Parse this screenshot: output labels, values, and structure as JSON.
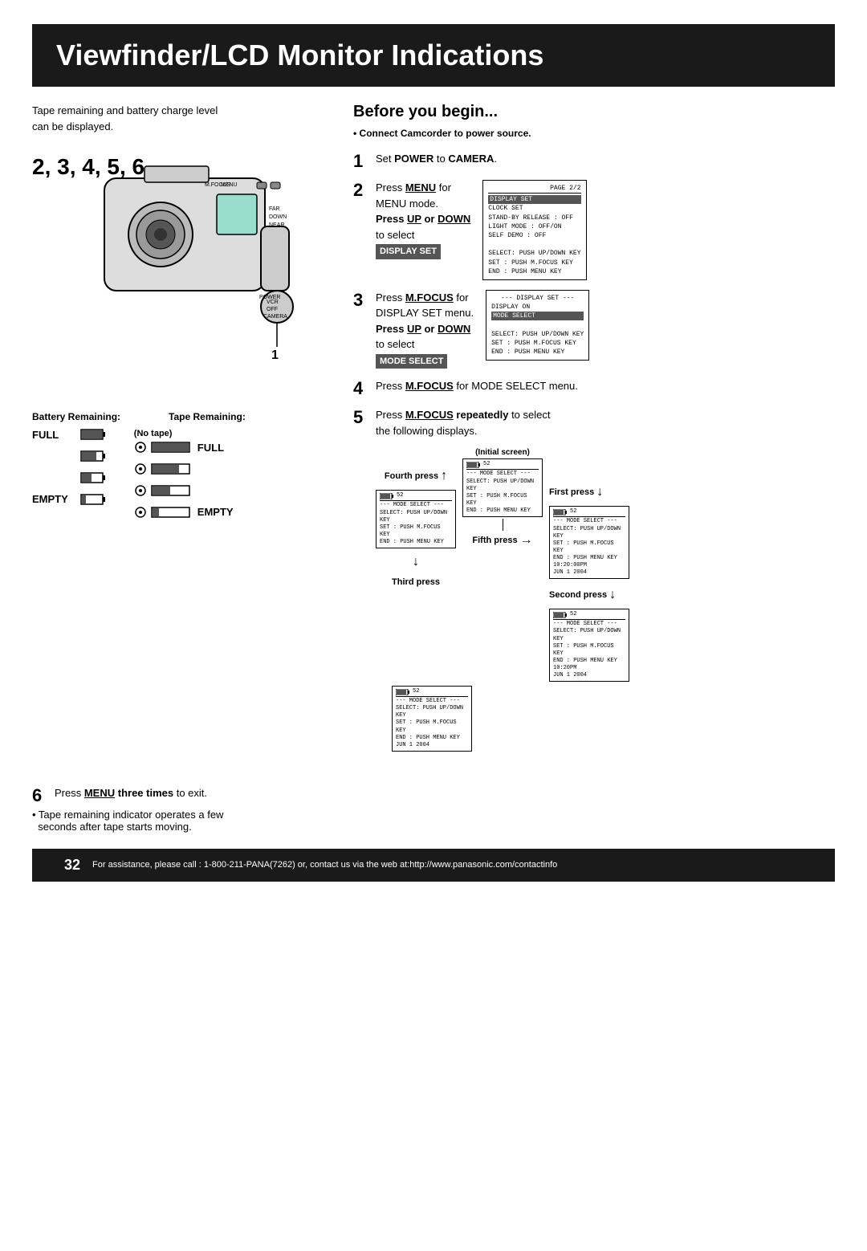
{
  "title": "Viewfinder/LCD Monitor Indications",
  "intro": {
    "line1": "Tape remaining and battery charge level",
    "line2": "can be displayed."
  },
  "before_heading": "Before you begin...",
  "connect_note": "Connect Camcorder to power source.",
  "steps": [
    {
      "num": "1",
      "text": "Set POWER to CAMERA."
    },
    {
      "num": "2",
      "text_pre": "Press ",
      "bold1": "MENU",
      "text1": " for\nMENU mode.\n",
      "bold2": "Press UP or DOWN",
      "text2": "\nto select\n",
      "highlight": "DISPLAY SET"
    },
    {
      "num": "3",
      "text_pre": "Press ",
      "bold1": "M.FOCUS",
      "text1": " for\nDISPLAY SET menu.\n",
      "bold2": "Press UP or DOWN",
      "text2": "\nto select\n",
      "highlight": "MODE SELECT"
    },
    {
      "num": "4",
      "text": "Press M.FOCUS for MODE SELECT menu."
    },
    {
      "num": "5",
      "text_pre": "Press ",
      "bold": "M.FOCUS repeatedly",
      "text": " to select\nthe following displays."
    }
  ],
  "step6": {
    "num": "6",
    "bold": "Press MENU three times",
    "text": " to exit."
  },
  "bottom_note": "• Tape remaining indicator operates a few\n  seconds after tape starts moving.",
  "battery_section": {
    "header1": "Battery Remaining:",
    "header2": "Tape Remaining:",
    "no_tape": "(No tape)",
    "full": "FULL",
    "empty": "EMPTY"
  },
  "number_label": "2, 3, 4, 5, 6",
  "press_labels": {
    "initial": "(Initial screen)",
    "fifth": "Fifth press",
    "first": "First press",
    "fourth": "Fourth press",
    "second": "Second press",
    "third": "Third press"
  },
  "menu_step2": {
    "header": "PAGE 2/2",
    "items": [
      "DISPLAY SET",
      "CLOCK SET",
      "STAND-BY RELEASE : OFF",
      "LIGHT MODE : OFF/ON",
      "SELF DEMO : OFF",
      "",
      "SELECT: PUSH UP/DOWN KEY",
      "SET    : PUSH M.FOCUS KEY",
      "END    : PUSH MENU KEY"
    ]
  },
  "menu_step3": {
    "header": "--- DISPLAY SET ---",
    "items": [
      "DISPLAY  ON",
      "MODE SELECT"
    ],
    "footer": [
      "SELECT: PUSH UP/DOWN KEY",
      "SET    : PUSH M.FOCUS KEY",
      "END    : PUSH MENU KEY"
    ]
  },
  "footer": {
    "num": "32",
    "text": "For assistance, please call : 1-800-211-PANA(7262) or, contact us via the web at:http://www.panasonic.com/contactinfo"
  }
}
